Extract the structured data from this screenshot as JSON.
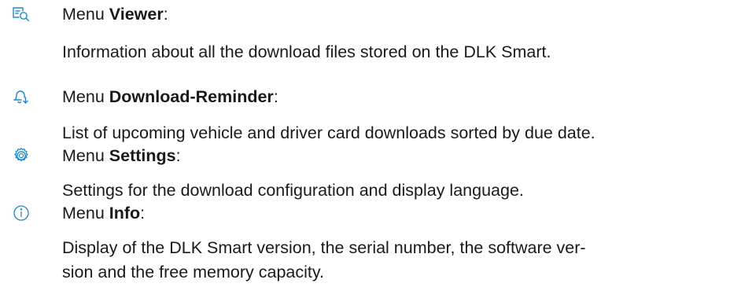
{
  "entries": [
    {
      "icon": "document-search-icon",
      "prefix": "Menu ",
      "name": "Viewer",
      "suffix": ":",
      "description": "Information about all the download files stored on the DLK Smart."
    },
    {
      "icon": "bell-download-icon",
      "prefix": "Menu ",
      "name": "Download-Reminder",
      "suffix": ":",
      "description": "List of upcoming vehicle and driver card downloads sorted by due date."
    },
    {
      "icon": "gear-icon",
      "prefix": "Menu ",
      "name": "Settings",
      "suffix": ":",
      "description": "Settings for the download configuration and display language."
    },
    {
      "icon": "info-icon",
      "prefix": "Menu ",
      "name": "Info",
      "suffix": ":",
      "description_lines": [
        "Display of the DLK Smart version, the serial number, the software ver-",
        "sion and the free memory capacity."
      ]
    }
  ],
  "colors": {
    "icon": "#1f88c8",
    "text": "#1a1a1a"
  }
}
